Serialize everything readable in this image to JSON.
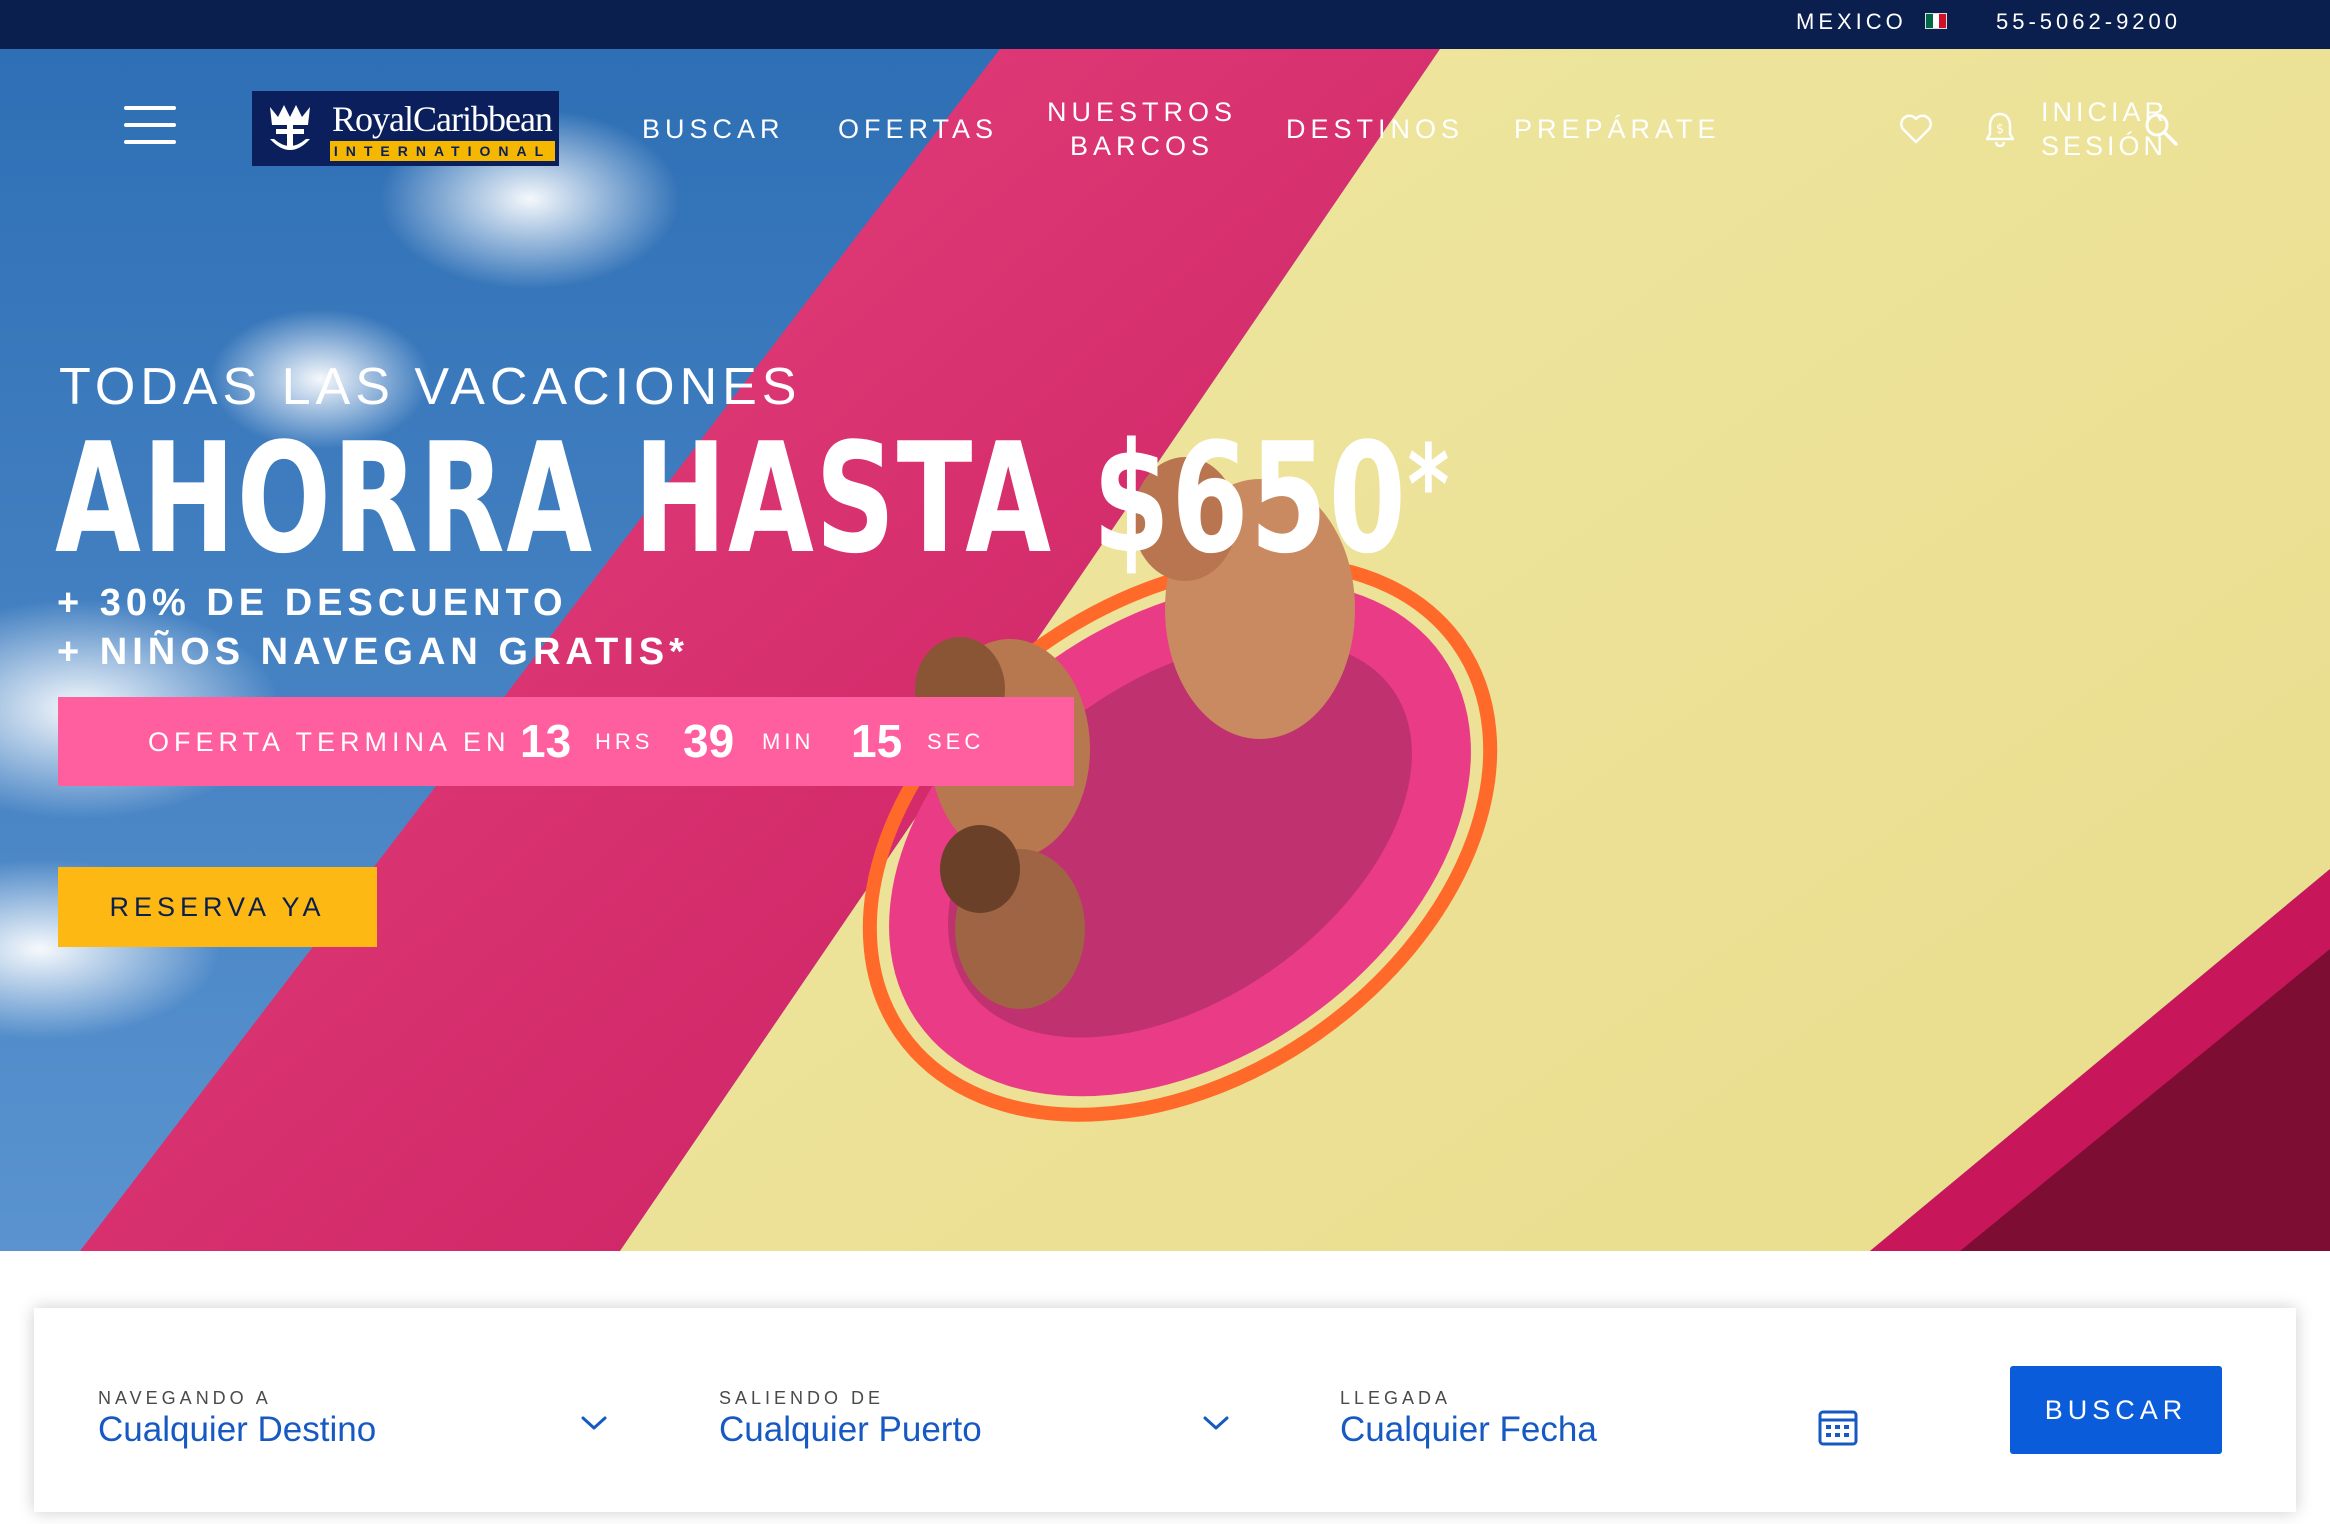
{
  "utility": {
    "country": "MEXICO",
    "flag_icon": "mexico-flag-icon",
    "phone": "55-5062-9200"
  },
  "header": {
    "menu_icon": "hamburger-menu-icon",
    "logo": {
      "brand": "RoyalCaribbean",
      "subtitle": "INTERNATIONAL"
    },
    "nav": [
      {
        "label": "BUSCAR"
      },
      {
        "label": "OFERTAS"
      },
      {
        "label": "NUESTROS",
        "label2": "BARCOS"
      },
      {
        "label": "DESTINOS"
      },
      {
        "label": "PREPÁRATE"
      }
    ],
    "favorites_icon": "heart-icon",
    "deals_icon": "bell-dollar-icon",
    "login": {
      "line1": "INICIAR",
      "line2": "SESIÓN"
    },
    "search_icon": "search-icon"
  },
  "hero": {
    "eyebrow": "TODAS LAS VACACIONES",
    "headline": "AHORRA HASTA $650",
    "headline_mark": "*",
    "line1": "+ 30% DE DESCUENTO",
    "line2": "+ NIÑOS NAVEGAN GRATIS*",
    "countdown": {
      "label": "OFERTA TERMINA EN",
      "hours": "13",
      "hours_unit": "HRS",
      "minutes": "39",
      "minutes_unit": "MIN",
      "seconds": "15",
      "seconds_unit": "SEC"
    },
    "cta": "RESERVA YA"
  },
  "search": {
    "destination": {
      "label": "NAVEGANDO A",
      "value": "Cualquier Destino"
    },
    "departure": {
      "label": "SALIENDO DE",
      "value": "Cualquier Puerto"
    },
    "arrival": {
      "label": "LLEGADA",
      "value": "Cualquier Fecha"
    },
    "button": "BUSCAR",
    "dropdown_icon": "chevron-down-icon",
    "calendar_icon": "calendar-icon"
  },
  "colors": {
    "navy": "#0a1f4d",
    "countdown_pink": "#ff5f9e",
    "cta_yellow": "#fdb813",
    "search_blue": "#0a5cdb",
    "value_blue": "#1659c2"
  }
}
